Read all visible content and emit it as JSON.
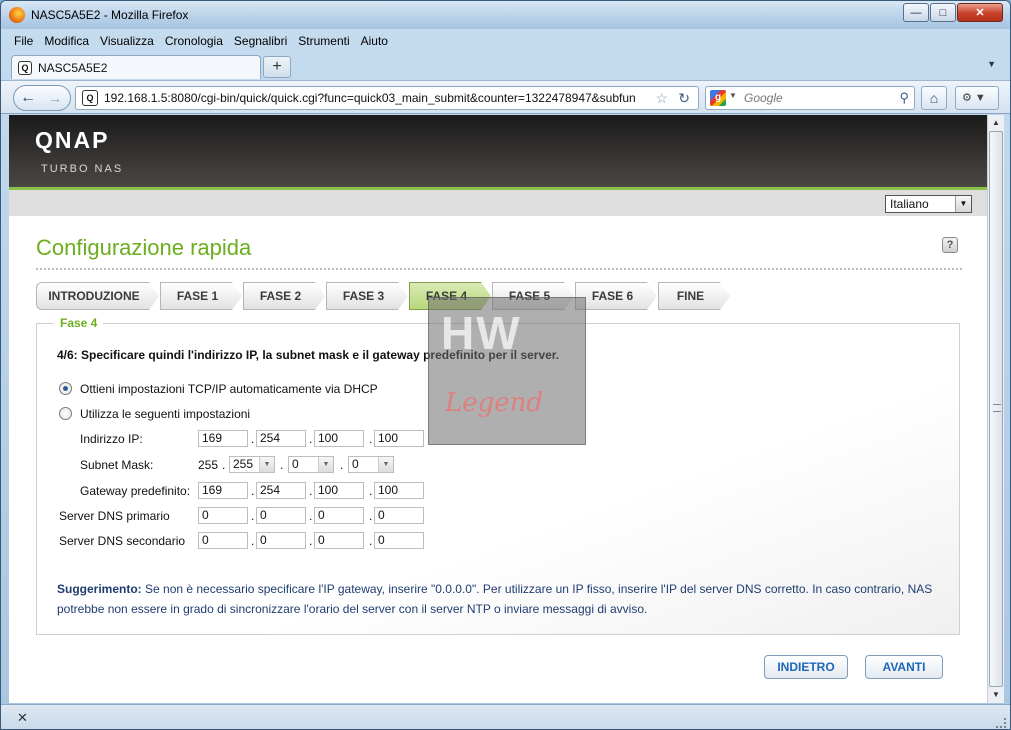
{
  "window": {
    "title": "NASC5A5E2 - Mozilla Firefox"
  },
  "menu": [
    "File",
    "Modifica",
    "Visualizza",
    "Cronologia",
    "Segnalibri",
    "Strumenti",
    "Aiuto"
  ],
  "tab": {
    "label": "NASC5A5E2"
  },
  "nav": {
    "url": "192.168.1.5:8080/cgi-bin/quick/quick.cgi?func=quick03_main_submit&counter=1322478947&subfun",
    "search_placeholder": "Google"
  },
  "qnap": {
    "logo": "QNAP",
    "subtitle": "TURBO NAS",
    "language": "Italiano"
  },
  "page": {
    "title": "Configurazione rapida"
  },
  "steps": [
    "INTRODUZIONE",
    "FASE 1",
    "FASE 2",
    "FASE 3",
    "FASE 4",
    "FASE 5",
    "FASE 6",
    "FINE"
  ],
  "active_step": "FASE 4",
  "section": {
    "legend": "Fase 4",
    "instruction": "4/6: Specificare quindi l'indirizzo IP, la subnet mask e il gateway predefinito per il server.",
    "option_dhcp": "Ottieni impostazioni TCP/IP automaticamente via DHCP",
    "option_static": "Utilizza le seguenti impostazioni",
    "selected_option": "dhcp"
  },
  "fields": {
    "ip": {
      "label": "Indirizzo IP:",
      "values": [
        "169",
        "254",
        "100",
        "100"
      ]
    },
    "mask": {
      "label": "Subnet Mask:",
      "fixed": "255",
      "values": [
        "255",
        "0",
        "0"
      ]
    },
    "gateway": {
      "label": "Gateway predefinito:",
      "values": [
        "169",
        "254",
        "100",
        "100"
      ]
    },
    "dns1": {
      "label": "Server DNS primario",
      "values": [
        "0",
        "0",
        "0",
        "0"
      ]
    },
    "dns2": {
      "label": "Server DNS secondario",
      "values": [
        "0",
        "0",
        "0",
        "0"
      ]
    }
  },
  "tip": {
    "label": "Suggerimento:",
    "text": " Se non è necessario specificare l'IP gateway, inserire \"0.0.0.0\". Per utilizzare un IP fisso, inserire l'IP del server DNS corretto. In caso contrario, NAS potrebbe non essere in grado di sincronizzare l'orario del server con il server NTP o inviare messaggi di avviso."
  },
  "buttons": {
    "back": "INDIETRO",
    "next": "AVANTI"
  },
  "watermark": {
    "top": "HW",
    "bottom": "Legend"
  },
  "colors": {
    "accent_green": "#6cae1e",
    "link_blue": "#1e66b8",
    "active_step": "#b9d77c"
  }
}
